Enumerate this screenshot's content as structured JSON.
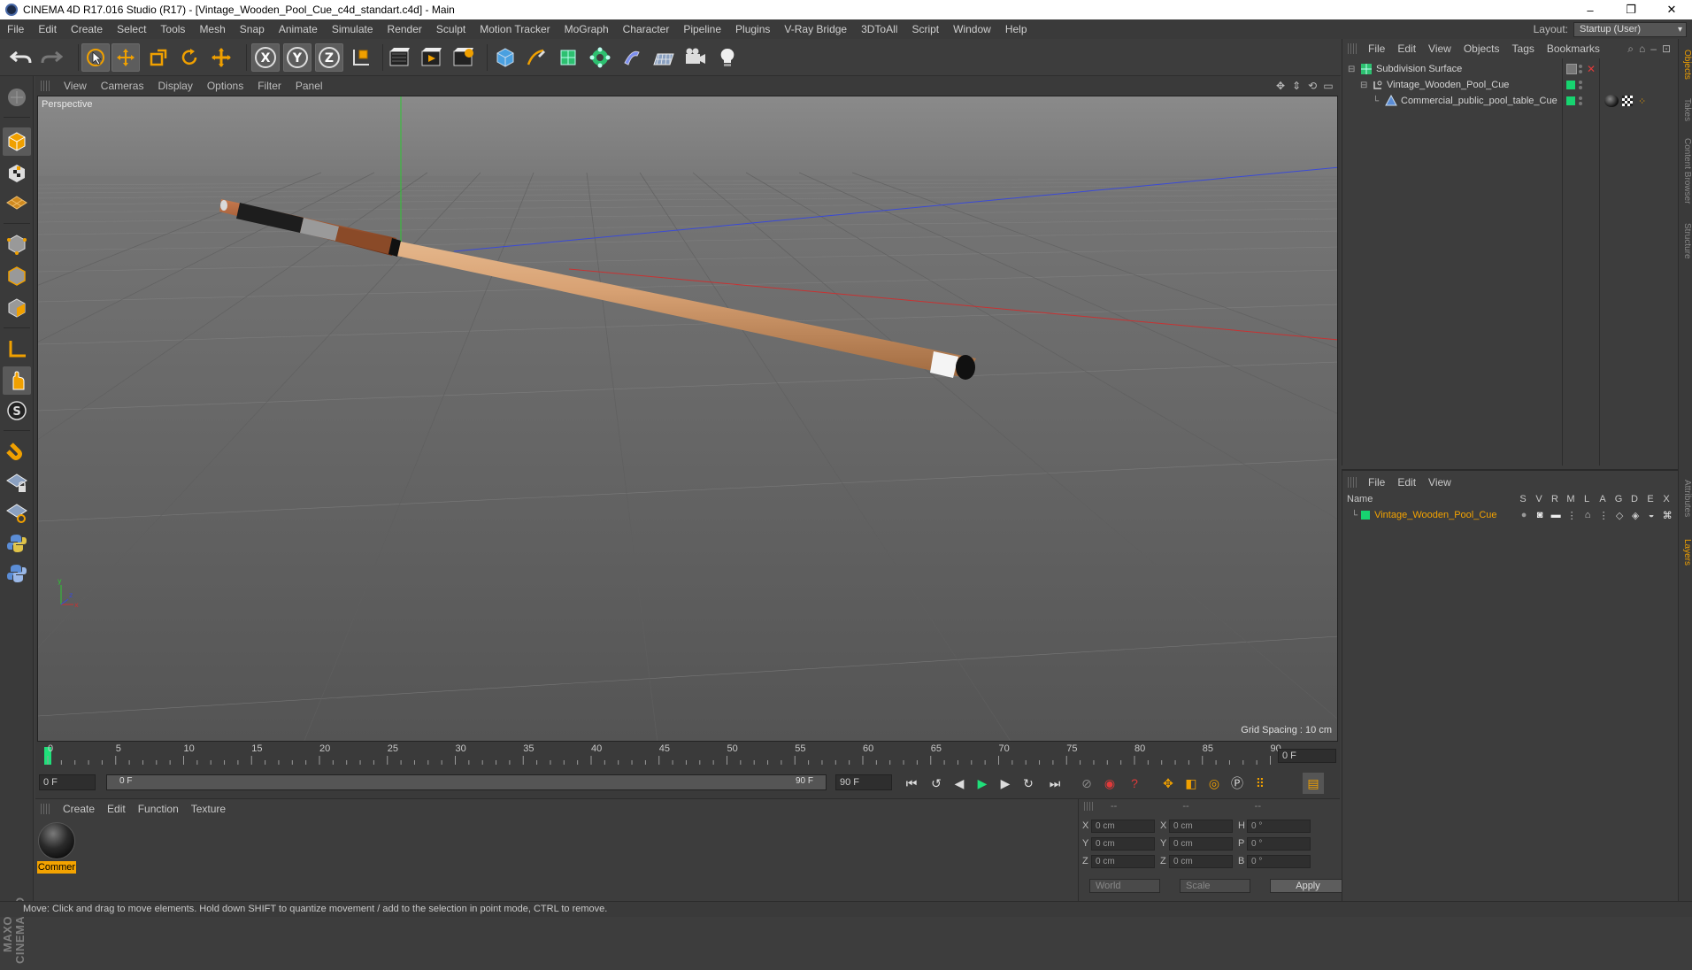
{
  "window": {
    "title": "CINEMA 4D R17.016 Studio (R17) - [Vintage_Wooden_Pool_Cue_c4d_standart.c4d] - Main",
    "minimize": "–",
    "maximize": "❐",
    "close": "✕"
  },
  "menubar": {
    "items": [
      "File",
      "Edit",
      "Create",
      "Select",
      "Tools",
      "Mesh",
      "Snap",
      "Animate",
      "Simulate",
      "Render",
      "Sculpt",
      "Motion Tracker",
      "MoGraph",
      "Character",
      "Pipeline",
      "Plugins",
      "V-Ray Bridge",
      "3DToAll",
      "Script",
      "Window",
      "Help"
    ],
    "layout_label": "Layout:",
    "layout_value": "Startup (User)"
  },
  "toolbar": {
    "x_label": "X",
    "y_label": "Y",
    "z_label": "Z"
  },
  "viewport": {
    "menu": [
      "View",
      "Cameras",
      "Display",
      "Options",
      "Filter",
      "Panel"
    ],
    "camera_label": "Perspective",
    "grid_spacing": "Grid Spacing : 10 cm"
  },
  "timeline": {
    "ticks": [
      "0",
      "5",
      "10",
      "15",
      "20",
      "25",
      "30",
      "35",
      "40",
      "45",
      "50",
      "55",
      "60",
      "65",
      "70",
      "75",
      "80",
      "85",
      "90"
    ],
    "current_frame": "0 F"
  },
  "transport": {
    "start_field": "0 F",
    "slider_start": "0 F",
    "slider_end": "90 F",
    "end_field": "90 F"
  },
  "materials": {
    "menu": [
      "Create",
      "Edit",
      "Function",
      "Texture"
    ],
    "items": [
      {
        "name": "Commer"
      }
    ]
  },
  "coordinates": {
    "headers": [
      "--",
      "--",
      "--"
    ],
    "rows": [
      {
        "l1": "X",
        "v1": "0 cm",
        "l2": "X",
        "v2": "0 cm",
        "l3": "H",
        "v3": "0 °"
      },
      {
        "l1": "Y",
        "v1": "0 cm",
        "l2": "Y",
        "v2": "0 cm",
        "l3": "P",
        "v3": "0 °"
      },
      {
        "l1": "Z",
        "v1": "0 cm",
        "l2": "Z",
        "v2": "0 cm",
        "l3": "B",
        "v3": "0 °"
      }
    ],
    "mode_world": "World",
    "mode_scale": "Scale",
    "apply": "Apply"
  },
  "objects": {
    "menu": [
      "File",
      "Edit",
      "View",
      "Objects",
      "Tags",
      "Bookmarks"
    ],
    "items": [
      {
        "name": "Subdivision Surface"
      },
      {
        "name": "Vintage_Wooden_Pool_Cue"
      },
      {
        "name": "Commercial_public_pool_table_Cue"
      }
    ]
  },
  "layers": {
    "menu": [
      "File",
      "Edit",
      "View"
    ],
    "name_header": "Name",
    "flags": [
      "S",
      "V",
      "R",
      "M",
      "L",
      "A",
      "G",
      "D",
      "E",
      "X"
    ],
    "row_name": "Vintage_Wooden_Pool_Cue",
    "row_color": "#17d470"
  },
  "right_tabs": [
    "Objects",
    "Takes",
    "Content Browser",
    "Structure",
    "Attributes",
    "Layers"
  ],
  "status": "Move: Click and drag to move elements. Hold down SHIFT to quantize movement / add to the selection in point mode, CTRL to remove.",
  "colors": {
    "accent": "#f4a300",
    "layer_green": "#17d470",
    "x_axis": "#c83232",
    "y_axis": "#2ec832",
    "z_axis": "#3a4ad8"
  }
}
